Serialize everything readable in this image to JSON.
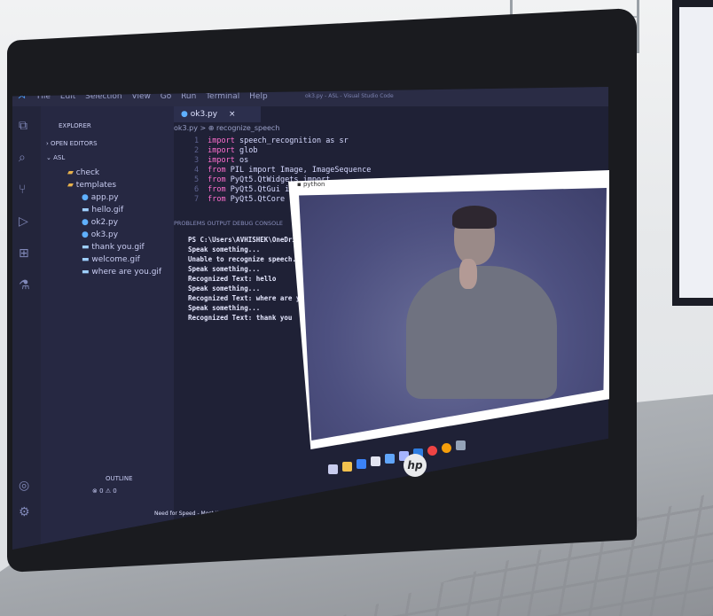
{
  "menu": [
    "File",
    "Edit",
    "Selection",
    "View",
    "Go",
    "Run",
    "Terminal",
    "Help"
  ],
  "window_title": "ok3.py - ASL - Visual Studio Code",
  "explorer": {
    "header": "EXPLORER",
    "open_editors": "OPEN EDITORS",
    "folder": "ASL",
    "items": [
      "check",
      "templates",
      "app.py",
      "hello.gif",
      "ok2.py",
      "ok3.py",
      "thank you.gif",
      "welcome.gif",
      "where are you.gif"
    ],
    "outline": "OUTLINE"
  },
  "editor": {
    "tab": "ok3.py",
    "breadcrumb": "ok3.py > ⊕ recognize_speech",
    "lines": [
      {
        "n": "1",
        "kw": "import",
        "rest": " speech_recognition as sr"
      },
      {
        "n": "2",
        "kw": "import",
        "rest": " glob"
      },
      {
        "n": "3",
        "kw": "import",
        "rest": " os"
      },
      {
        "n": "4",
        "kw": "from",
        "rest": " PIL import Image, ImageSequence"
      },
      {
        "n": "5",
        "kw": "from",
        "rest": " PyQt5.QtWidgets import"
      },
      {
        "n": "6",
        "kw": "from",
        "rest": " PyQt5.QtGui import"
      },
      {
        "n": "7",
        "kw": "from",
        "rest": " PyQt5.QtCore import"
      }
    ]
  },
  "panel_tabs": "PROBLEMS   OUTPUT   DEBUG CONSOLE",
  "terminal": [
    "PS C:\\Users\\AVHISHEK\\OneDrive\\D",
    "Speak something...",
    "Unable to recognize speech. Ple",
    "Speak something...",
    "Recognized Text: hello",
    "Speak something...",
    "Recognized Text: where are you",
    "Speak something...",
    "Recognized Text: thank you"
  ],
  "video_window_title": "python",
  "status_bar": "⊗ 0 ⚠ 0",
  "taskbar_now_playing": "Need for Speed - Most Wanted",
  "laptop_brand": "hp"
}
